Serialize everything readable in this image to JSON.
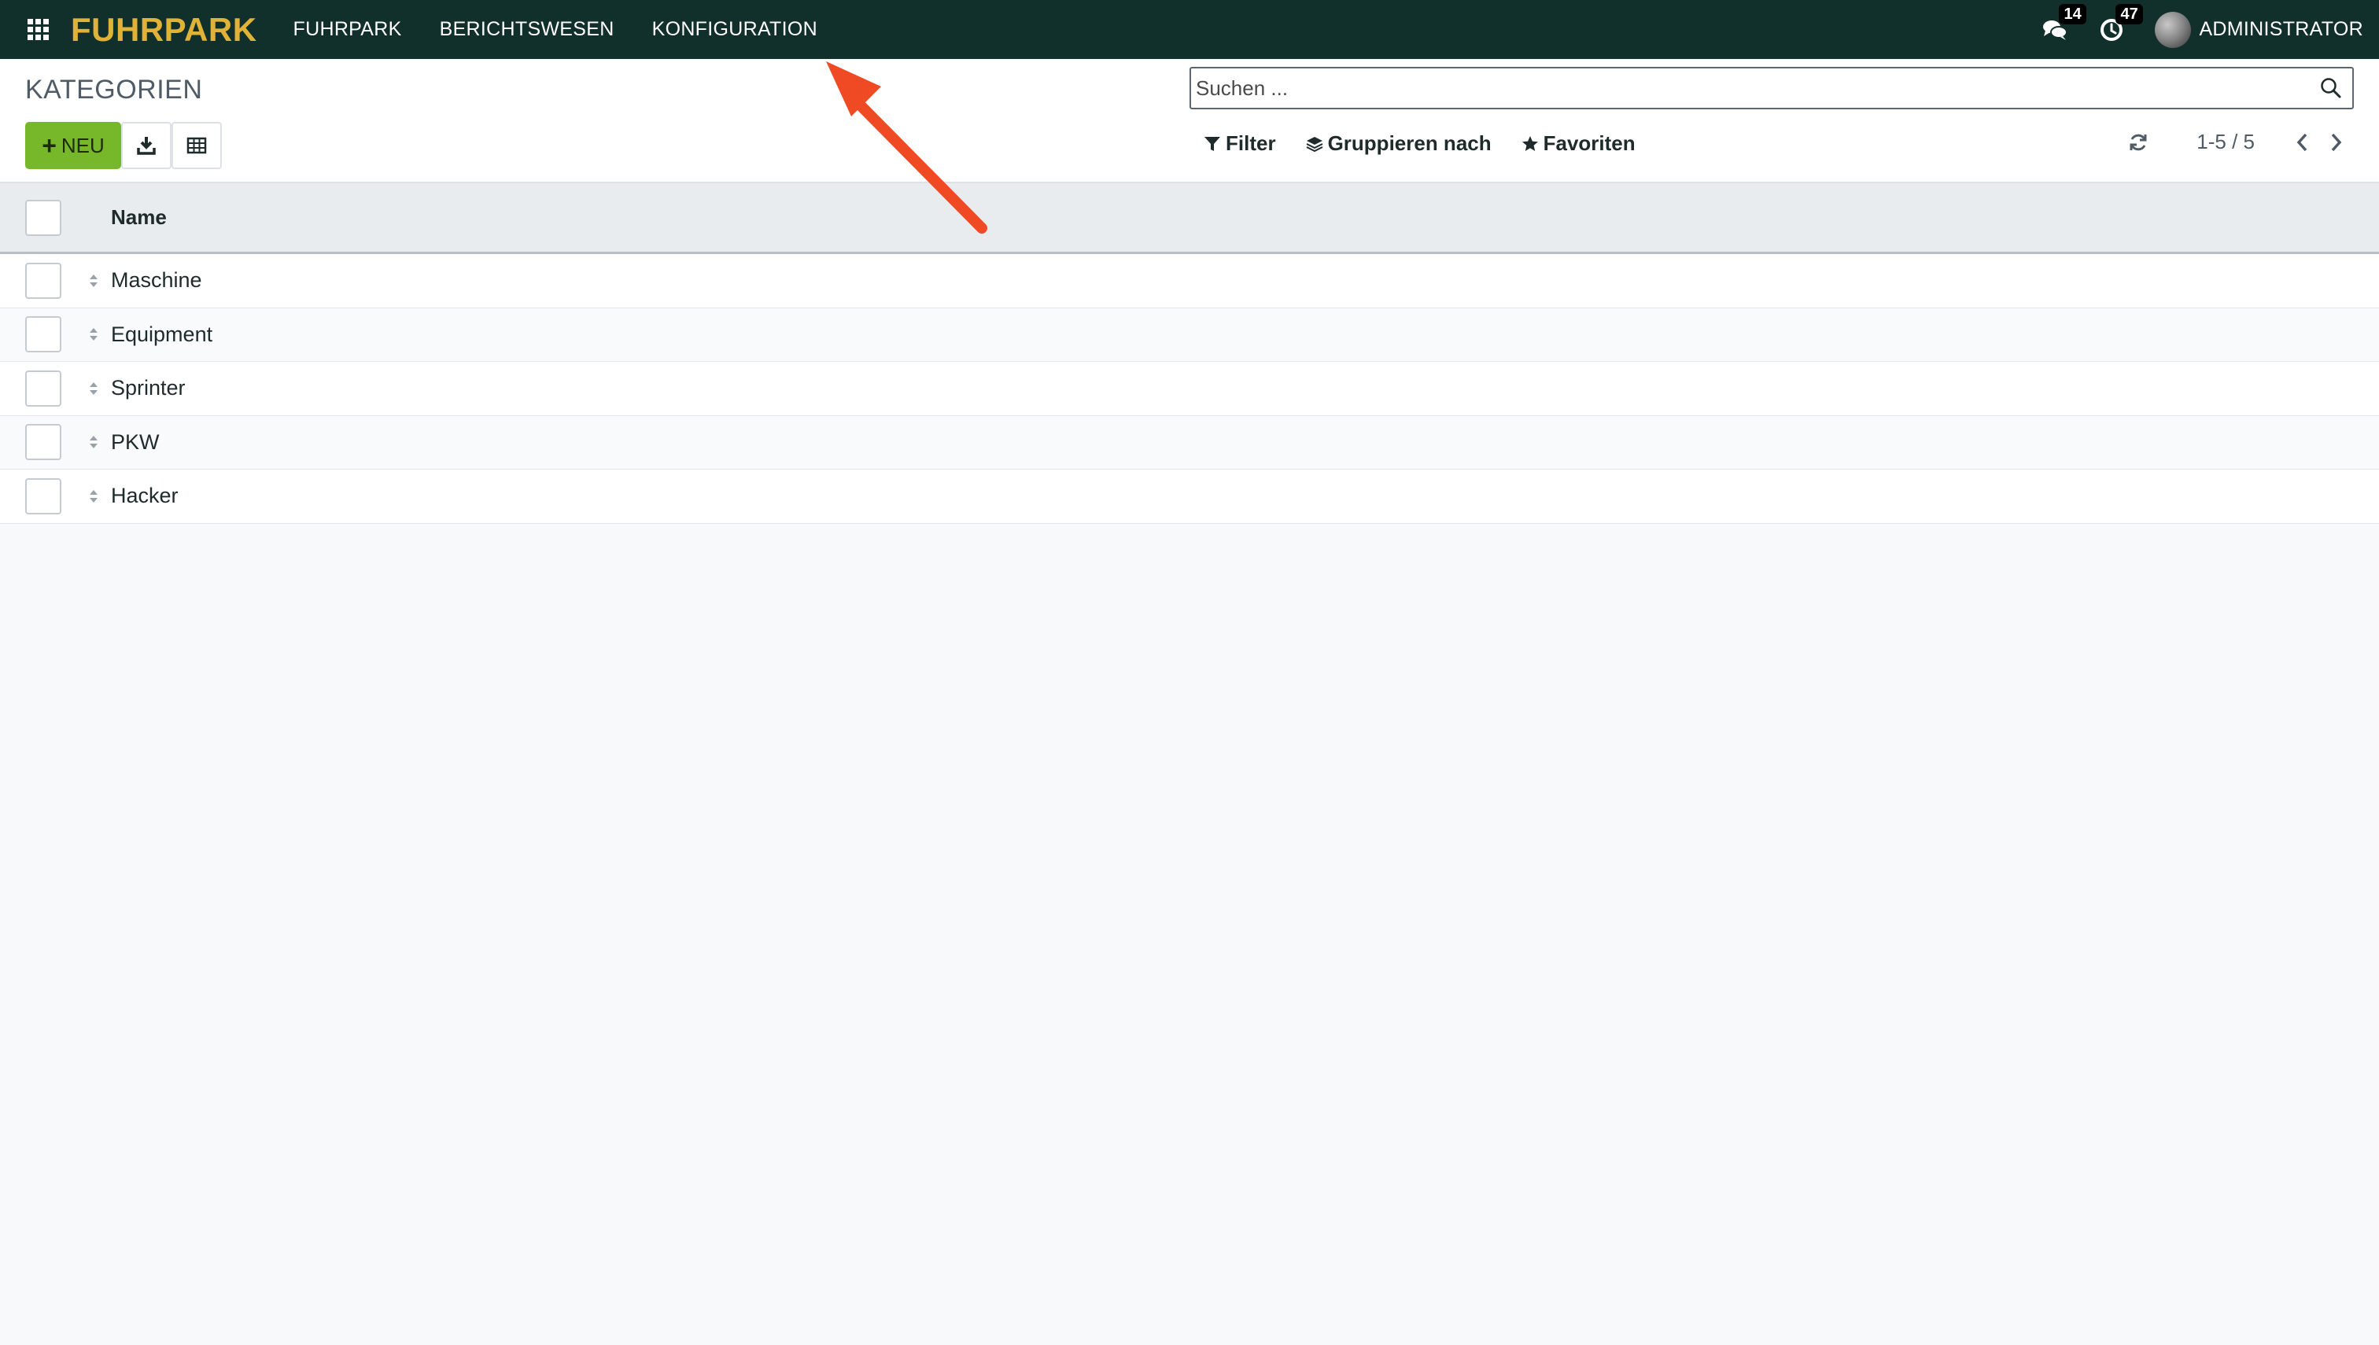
{
  "navbar": {
    "brand": "FUHRPARK",
    "menu": [
      "FUHRPARK",
      "BERICHTSWESEN",
      "KONFIGURATION"
    ],
    "messages_count": "14",
    "activities_count": "47",
    "user": "ADMINISTRATOR"
  },
  "control_panel": {
    "title": "KATEGORIEN",
    "new_label": "NEU",
    "search_placeholder": "Suchen ...",
    "filter_label": "Filter",
    "groupby_label": "Gruppieren nach",
    "favorites_label": "Favoriten",
    "pager_value": "1-5 / 5"
  },
  "list": {
    "column_name": "Name",
    "rows": [
      "Maschine",
      "Equipment",
      "Sprinter",
      "PKW",
      "Hacker"
    ]
  },
  "colors": {
    "navbar_bg": "#12302b",
    "brand": "#e0b238",
    "new_button": "#76b82a",
    "annotation_arrow": "#f04a24"
  }
}
